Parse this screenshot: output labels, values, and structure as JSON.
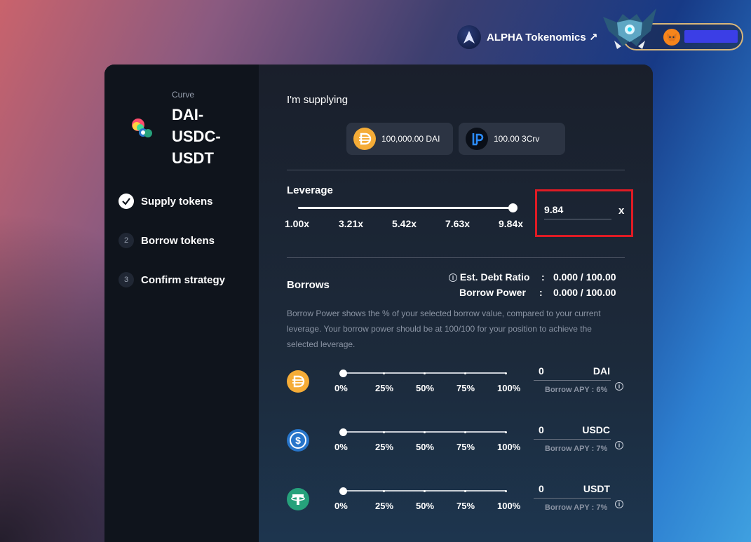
{
  "topbar": {
    "brand_label": "ALPHA Tokenomics ↗",
    "wallet_icon": "metamask-fox-icon"
  },
  "sidebar": {
    "provider": "Curve",
    "pool_name": "DAI-USDC-USDT",
    "steps": [
      {
        "label": "Supply tokens",
        "number": "",
        "done": true
      },
      {
        "label": "Borrow tokens",
        "number": "2",
        "done": false
      },
      {
        "label": "Confirm strategy",
        "number": "3",
        "done": false
      }
    ]
  },
  "supply": {
    "title": "I'm supplying",
    "tokens": [
      {
        "amount_label": "100,000.00 DAI",
        "icon": "dai-icon"
      },
      {
        "amount_label": "100.00 3Crv",
        "icon": "lp-icon"
      }
    ]
  },
  "leverage": {
    "title": "Leverage",
    "ticks": [
      "1.00x",
      "3.21x",
      "5.42x",
      "7.63x",
      "9.84x"
    ],
    "value_fraction": 1.0,
    "input_value": "9.84",
    "input_suffix": "x"
  },
  "borrows": {
    "title": "Borrows",
    "debt_ratio_label": "Est. Debt Ratio",
    "debt_ratio_value": "0.000 / 100.00",
    "borrow_power_label": "Borrow Power",
    "borrow_power_value": "0.000 / 100.00",
    "help_text": "Borrow Power shows the % of your selected borrow value, compared to your current leverage. Your borrow power should be at 100/100 for your position to achieve the selected leverage.",
    "ticks": [
      "0%",
      "25%",
      "50%",
      "75%",
      "100%"
    ],
    "tokens": [
      {
        "symbol": "DAI",
        "amount": "0",
        "apy_label": "Borrow APY : 6%",
        "icon": "dai-icon",
        "color": "#f5ac37",
        "slider_fraction": 0
      },
      {
        "symbol": "USDC",
        "amount": "0",
        "apy_label": "Borrow APY : 7%",
        "icon": "usdc-icon",
        "color": "#2775ca",
        "slider_fraction": 0
      },
      {
        "symbol": "USDT",
        "amount": "0",
        "apy_label": "Borrow APY : 7%",
        "icon": "usdt-icon",
        "color": "#26a17b",
        "slider_fraction": 0
      }
    ]
  },
  "colors": {
    "highlight_border": "#e01b24",
    "sidebar_bg": "#0f141c",
    "chip_bg": "#2c3443"
  }
}
